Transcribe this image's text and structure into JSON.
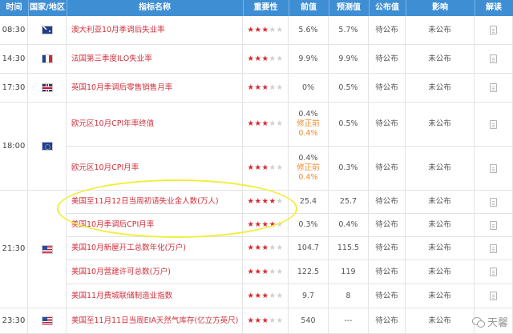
{
  "header": {
    "time": "时间",
    "country": "国家/地区",
    "indicator": "指标名称",
    "importance": "重要性",
    "previous": "前值",
    "forecast": "预测值",
    "published": "公布值",
    "impact": "影响",
    "interpret": "解读"
  },
  "groups": {
    "g0": {
      "time": "08:30",
      "flag": "flag-au"
    },
    "g1": {
      "time": "14:30",
      "flag": "flag-fr"
    },
    "g2": {
      "time": "17:30",
      "flag": "flag-uk"
    },
    "g3": {
      "time": "18:00",
      "flag": "flag-eu"
    },
    "g4": {
      "time": "21:30",
      "flag": "flag-us"
    },
    "g5": {
      "time": "23:30",
      "flag": "flag-us"
    }
  },
  "rows": [
    {
      "name": "澳大利亚10月季调后失业率",
      "stars": 3,
      "previous": "5.6%",
      "forecast": "5.7%",
      "published": "待公布",
      "impact": "未公布"
    },
    {
      "name": "法国第三季度ILO失业率",
      "stars": 3,
      "previous": "9.9%",
      "forecast": "9.9%",
      "published": "待公布",
      "impact": "未公布"
    },
    {
      "name": "英国10月季调后零售销售月率",
      "stars": 3,
      "previous": "0%",
      "forecast": "0.5%",
      "published": "待公布",
      "impact": "未公布"
    },
    {
      "name": "欧元区10月CPI年率终值",
      "stars": 3,
      "previous": "0.4%",
      "revised_label": "修正前",
      "revised_value": "0.4%",
      "forecast": "0.5%",
      "published": "待公布",
      "impact": "未公布"
    },
    {
      "name": "欧元区10月CPI月率",
      "stars": 3,
      "previous": "0.4%",
      "revised_label": "修正前",
      "revised_value": "0.4%",
      "forecast": "0.3%",
      "published": "待公布",
      "impact": "未公布"
    },
    {
      "name": "美国至11月12日当周初请失业金人数(万人)",
      "stars": 4,
      "previous": "25.4",
      "forecast": "25.7",
      "published": "待公布",
      "impact": "未公布"
    },
    {
      "name": "美国10月季调后CPI月率",
      "stars": 4,
      "previous": "0.3%",
      "forecast": "0.4%",
      "published": "待公布",
      "impact": "未公布"
    },
    {
      "name": "美国10月新屋开工总数年化(万户)",
      "stars": 3,
      "previous": "104.7",
      "forecast": "115.5",
      "published": "待公布",
      "impact": "未公布"
    },
    {
      "name": "美国10月营建许可总数(万户)",
      "stars": 3,
      "previous": "122.5",
      "forecast": "119",
      "published": "待公布",
      "impact": "未公布"
    },
    {
      "name": "美国11月费城联储制造业指数",
      "stars": 3,
      "previous": "9.7",
      "forecast": "8",
      "published": "待公布",
      "impact": "未公布"
    },
    {
      "name": "美国至11月11日当周EIA天然气库存(亿立方英尺)",
      "stars": 3,
      "previous": "540",
      "forecast": "---",
      "published": "待公布",
      "impact": "未公布"
    }
  ],
  "watermark": "天馨"
}
